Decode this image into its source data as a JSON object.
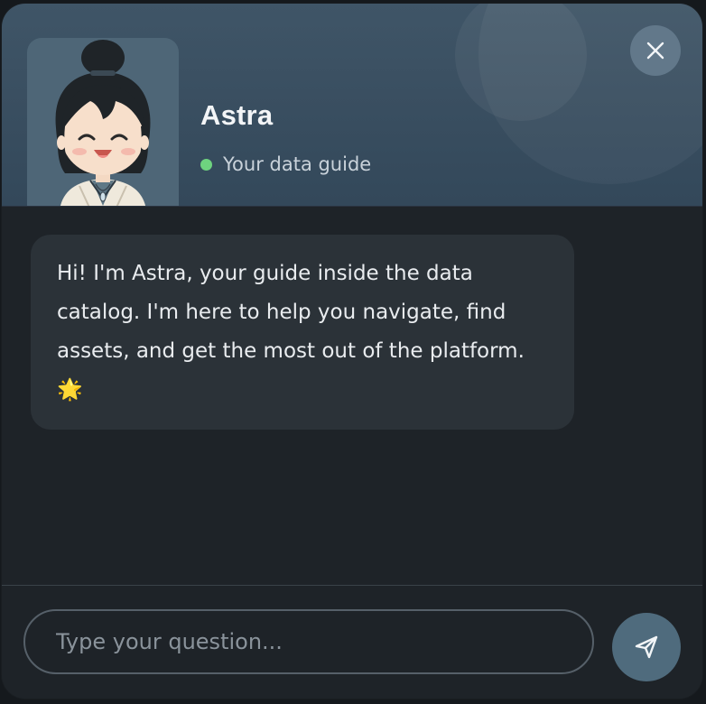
{
  "assistant": {
    "name": "Astra",
    "status": "Your data guide",
    "status_color": "#6ed37f",
    "avatar": "chibi-character-avatar"
  },
  "header": {
    "close_icon": "close-icon",
    "accent_color": "#3f5567"
  },
  "messages": [
    {
      "sender": "assistant",
      "text": "Hi! I'm Astra, your guide inside the data catalog. I'm here to help you navigate, find assets, and get the most out of the platform. 🌟"
    }
  ],
  "composer": {
    "placeholder": "Type your question...",
    "value": "",
    "send_icon": "send-icon",
    "send_color": "#4f6b7d"
  }
}
